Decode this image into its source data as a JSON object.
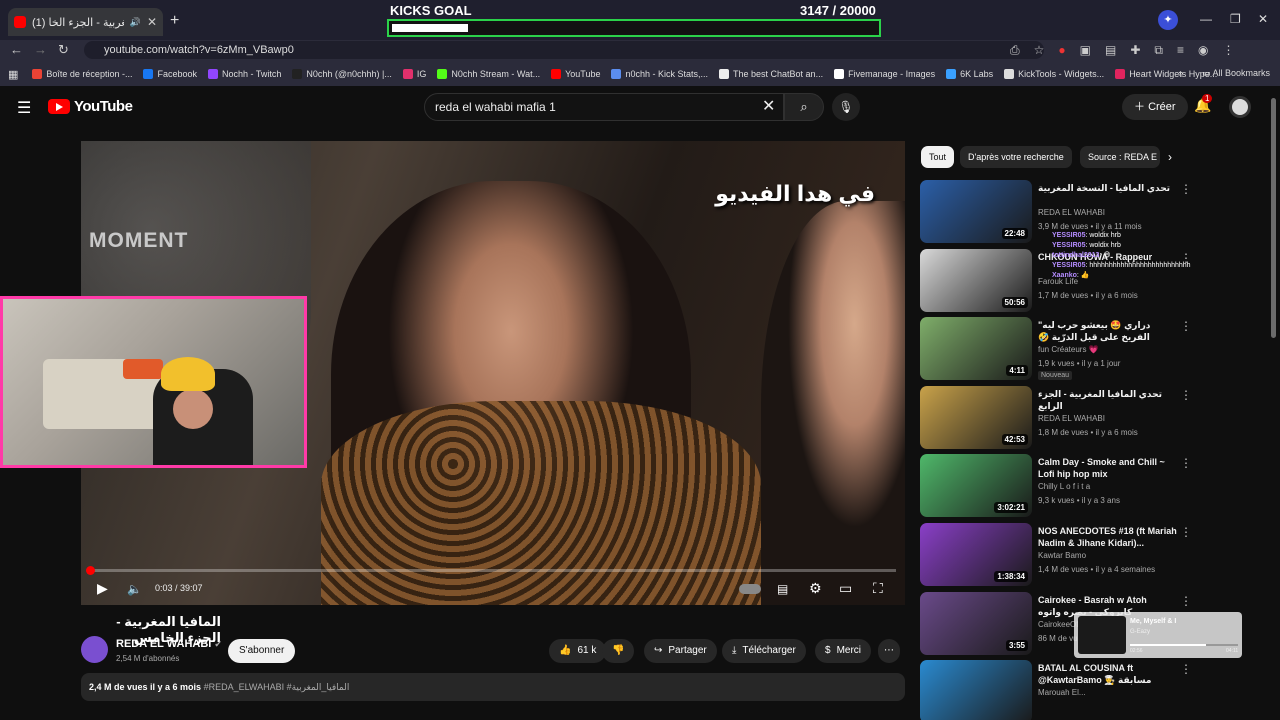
{
  "browser": {
    "tab_title": "(1) المافيا المغربية - الجزء الخا",
    "url": "youtube.com/watch?v=6zMm_VBawp0",
    "bookmarks": [
      {
        "label": "Boîte de réception -...",
        "color": "#ea4335"
      },
      {
        "label": "Facebook",
        "color": "#1877f2"
      },
      {
        "label": "Nochh - Twitch",
        "color": "#9146ff"
      },
      {
        "label": "N0chh (@n0chhh) |...",
        "color": "#222222"
      },
      {
        "label": "IG",
        "color": "#e1306c"
      },
      {
        "label": "N0chh Stream - Wat...",
        "color": "#53fc18"
      },
      {
        "label": "YouTube",
        "color": "#ff0000"
      },
      {
        "label": "n0chh - Kick Stats,...",
        "color": "#5b8def"
      },
      {
        "label": "The best ChatBot an...",
        "color": "#eeeeee"
      },
      {
        "label": "Fivemanage - Images",
        "color": "#ffffff"
      },
      {
        "label": "6K Labs",
        "color": "#3aa0ff"
      },
      {
        "label": "KickTools - Widgets...",
        "color": "#dddddd"
      },
      {
        "label": "Heart Widgets Hype...",
        "color": "#e0245e"
      }
    ],
    "all_bookmarks": "All Bookmarks"
  },
  "goal": {
    "title": "KICKS GOAL",
    "count": "3147   / 20000",
    "progress": 0.157
  },
  "youtube": {
    "logo": "YouTube",
    "search_query": "reda el wahabi mafia 1",
    "create_label": "Créer",
    "notification_count": "1"
  },
  "player": {
    "overlay_text_left": "MOMENT",
    "subtitle": "في هدا الفيديو",
    "time": "0:03 / 39:07",
    "progress": 0.0013
  },
  "video": {
    "title": "المافيا المغربية - الجزء الخامس",
    "channel": "REDA EL WAHABI",
    "subscribers": "2,54 M d'abonnés",
    "subscribe_label": "S'abonner",
    "likes": "61 k",
    "share_label": "Partager",
    "download_label": "Télécharger",
    "thanks_label": "Merci",
    "views_date": "2,4 M de vues  il y a 6 mois",
    "tags": "#REDA_ELWAHABI #المافيا_المغربية"
  },
  "chips": [
    {
      "label": "Tout",
      "active": true
    },
    {
      "label": "D'après votre recherche",
      "active": false
    },
    {
      "label": "Source : REDA E",
      "active": false
    }
  ],
  "recommendations": [
    {
      "title": "تحدي المافيا - النسخة المغربية",
      "channel": "REDA EL WAHABI",
      "meta": "3,9 M de vues • il y a 11 mois",
      "duration": "22:48",
      "badge": "",
      "thumb": "#2b5fa8"
    },
    {
      "title": "CHKOUN HOWA - Rappeur",
      "channel": "Farouk Life",
      "meta": "1,7 M de vues • il y a 6 mois",
      "duration": "50:56",
      "badge": "",
      "thumb": "#d9d9d9"
    },
    {
      "title": "\"دراري 🤩 بيعشو حرب ليه الفريخ على قبل الذرّية 🤣 شوفو شنو وقع\"",
      "channel": "fun Créateurs 💗",
      "meta": "1,9 k vues • il y a 1 jour",
      "duration": "4:11",
      "badge": "Nouveau",
      "thumb": "#7fae6a"
    },
    {
      "title": "تحدي المافيا المغربية - الجزء الرابع",
      "channel": "REDA EL WAHABI",
      "meta": "1,8 M de vues • il y a 6 mois",
      "duration": "42:53",
      "badge": "",
      "thumb": "#c9a24a"
    },
    {
      "title": "Calm Day - Smoke and Chill ~ Lofi hip hop mix",
      "channel": "Chilly L o f i t a",
      "meta": "9,3 k vues • il y a 3 ans",
      "duration": "3:02:21",
      "badge": "",
      "thumb": "#4fb86a"
    },
    {
      "title": "NOS ANECDOTES #18 (ft Mariah Nadim & Jihane Kidari)...",
      "channel": "Kawtar Bamo",
      "meta": "1,4 M de vues • il y a 4 semaines",
      "duration": "1:38:34",
      "badge": "",
      "thumb": "#8a3fc8"
    },
    {
      "title": "Cairokee - Basrah w Atoh كايروكي - بصره واتوه",
      "channel": "CairokeeOfficial",
      "meta": "86 M de vues",
      "duration": "3:55",
      "badge": "",
      "thumb": "#6a4a8a"
    },
    {
      "title": "BATAL AL COUSINA ft @KawtarBamo 👨‍🍳 مسابقة الطبخ مع",
      "channel": "Marouah El...",
      "meta": "",
      "duration": "",
      "badge": "",
      "thumb": "#2a8ad0"
    }
  ],
  "chat": [
    {
      "user": "YESSIR05",
      "msg": ": woldix hrb"
    },
    {
      "user": "YESSIR05",
      "msg": ": woldix hrb"
    },
    {
      "user": "tottindhal2013",
      "msg": ": 😄"
    },
    {
      "user": "YESSIR05",
      "msg": ": hhhhhhhhhhhhhhhhhhhhhhhhhh"
    },
    {
      "user": "Xaanko",
      "msg": ": 👍"
    }
  ],
  "music": {
    "title": "Me, Myself & I",
    "artist": "G-Eazy",
    "elapsed": "02:56",
    "total": "04:11",
    "progress": 0.7
  },
  "colors": {
    "goal_border": "#2bd24a",
    "webcam_border": "#ff3aa8",
    "yt_red": "#ff0000"
  }
}
